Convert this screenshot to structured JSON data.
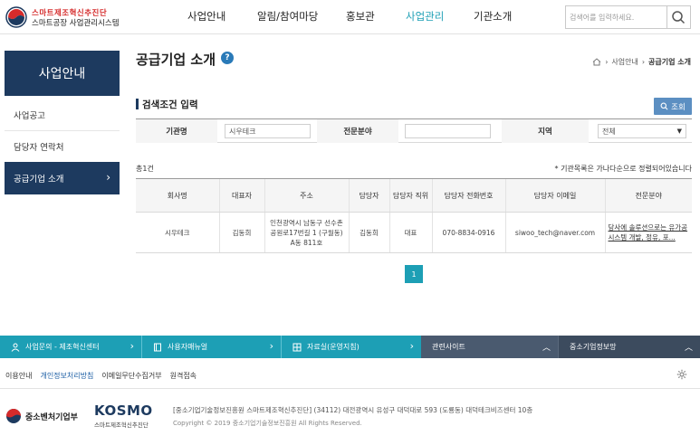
{
  "header": {
    "logo_top": "스마트제조혁신추진단",
    "logo_bottom": "스마트공장 사업관리시스템",
    "nav": [
      "사업안내",
      "알림/참여마당",
      "홍보관",
      "사업관리",
      "기관소개"
    ],
    "nav_active": "사업관리",
    "search_placeholder": "검색어를 입력하세요."
  },
  "sidebar": {
    "title": "사업안내",
    "items": [
      {
        "label": "사업공고"
      },
      {
        "label": "담당자 연락처"
      },
      {
        "label": "공급기업 소개"
      }
    ],
    "active_index": 2
  },
  "main": {
    "title": "공급기업 소개",
    "help": "?",
    "breadcrumb": [
      "사업안내",
      "공급기업 소개"
    ],
    "search_section_title": "검색조건 입력",
    "query_button": "조회",
    "filters": {
      "company_label": "기관명",
      "company_value": "시우테크",
      "field_label": "전문분야",
      "field_value": "",
      "region_label": "지역",
      "region_value": "전체"
    },
    "total": "총1건",
    "note": "* 기관목록은 가나다순으로 정렬되어있습니다",
    "table": {
      "headers": [
        "회사명",
        "대표자",
        "주소",
        "담당자",
        "담당자 직위",
        "담당자 전화번호",
        "담당자 이메일",
        "전문분야"
      ],
      "rows": [
        [
          "시우테크",
          "김동희",
          "인천광역시 남동구 선수촌공원로17번길 1 (구월동) A동 811호",
          "김동희",
          "대표",
          "070-8834-0916",
          "siwoo_tech@naver.com",
          "당사에 솔루션으로는 유가공시스템 개발, 정유, 포..."
        ]
      ]
    },
    "page": "1"
  },
  "footer": {
    "bars": [
      "사업문의 - 제조혁신센터",
      "사용자매뉴얼",
      "자료실(운영지침)",
      "관련사이트",
      "중소기업정보망"
    ],
    "links": [
      "이용안내",
      "개인정보처리방침",
      "이메일무단수집거부",
      "원격접속"
    ],
    "org1": "중소벤처기업부",
    "org2": "KOSMO",
    "org2_sub": "스마트제조혁신추진단",
    "address": "[중소기업기술정보진흥원 스마트제조혁신추진단] (34112) 대전광역시 유성구 대덕대로 593 (도룡동) 대덕테크비즈센터 10층",
    "copyright": "Copyright © 2019 중소기업기술정보진흥원 All Rights Reserved."
  },
  "colors": {
    "navy": "#1d3a5f",
    "teal": "#1d9fb5",
    "button_blue": "#5c8fc2",
    "dark_bar": "#4a5a6f"
  }
}
